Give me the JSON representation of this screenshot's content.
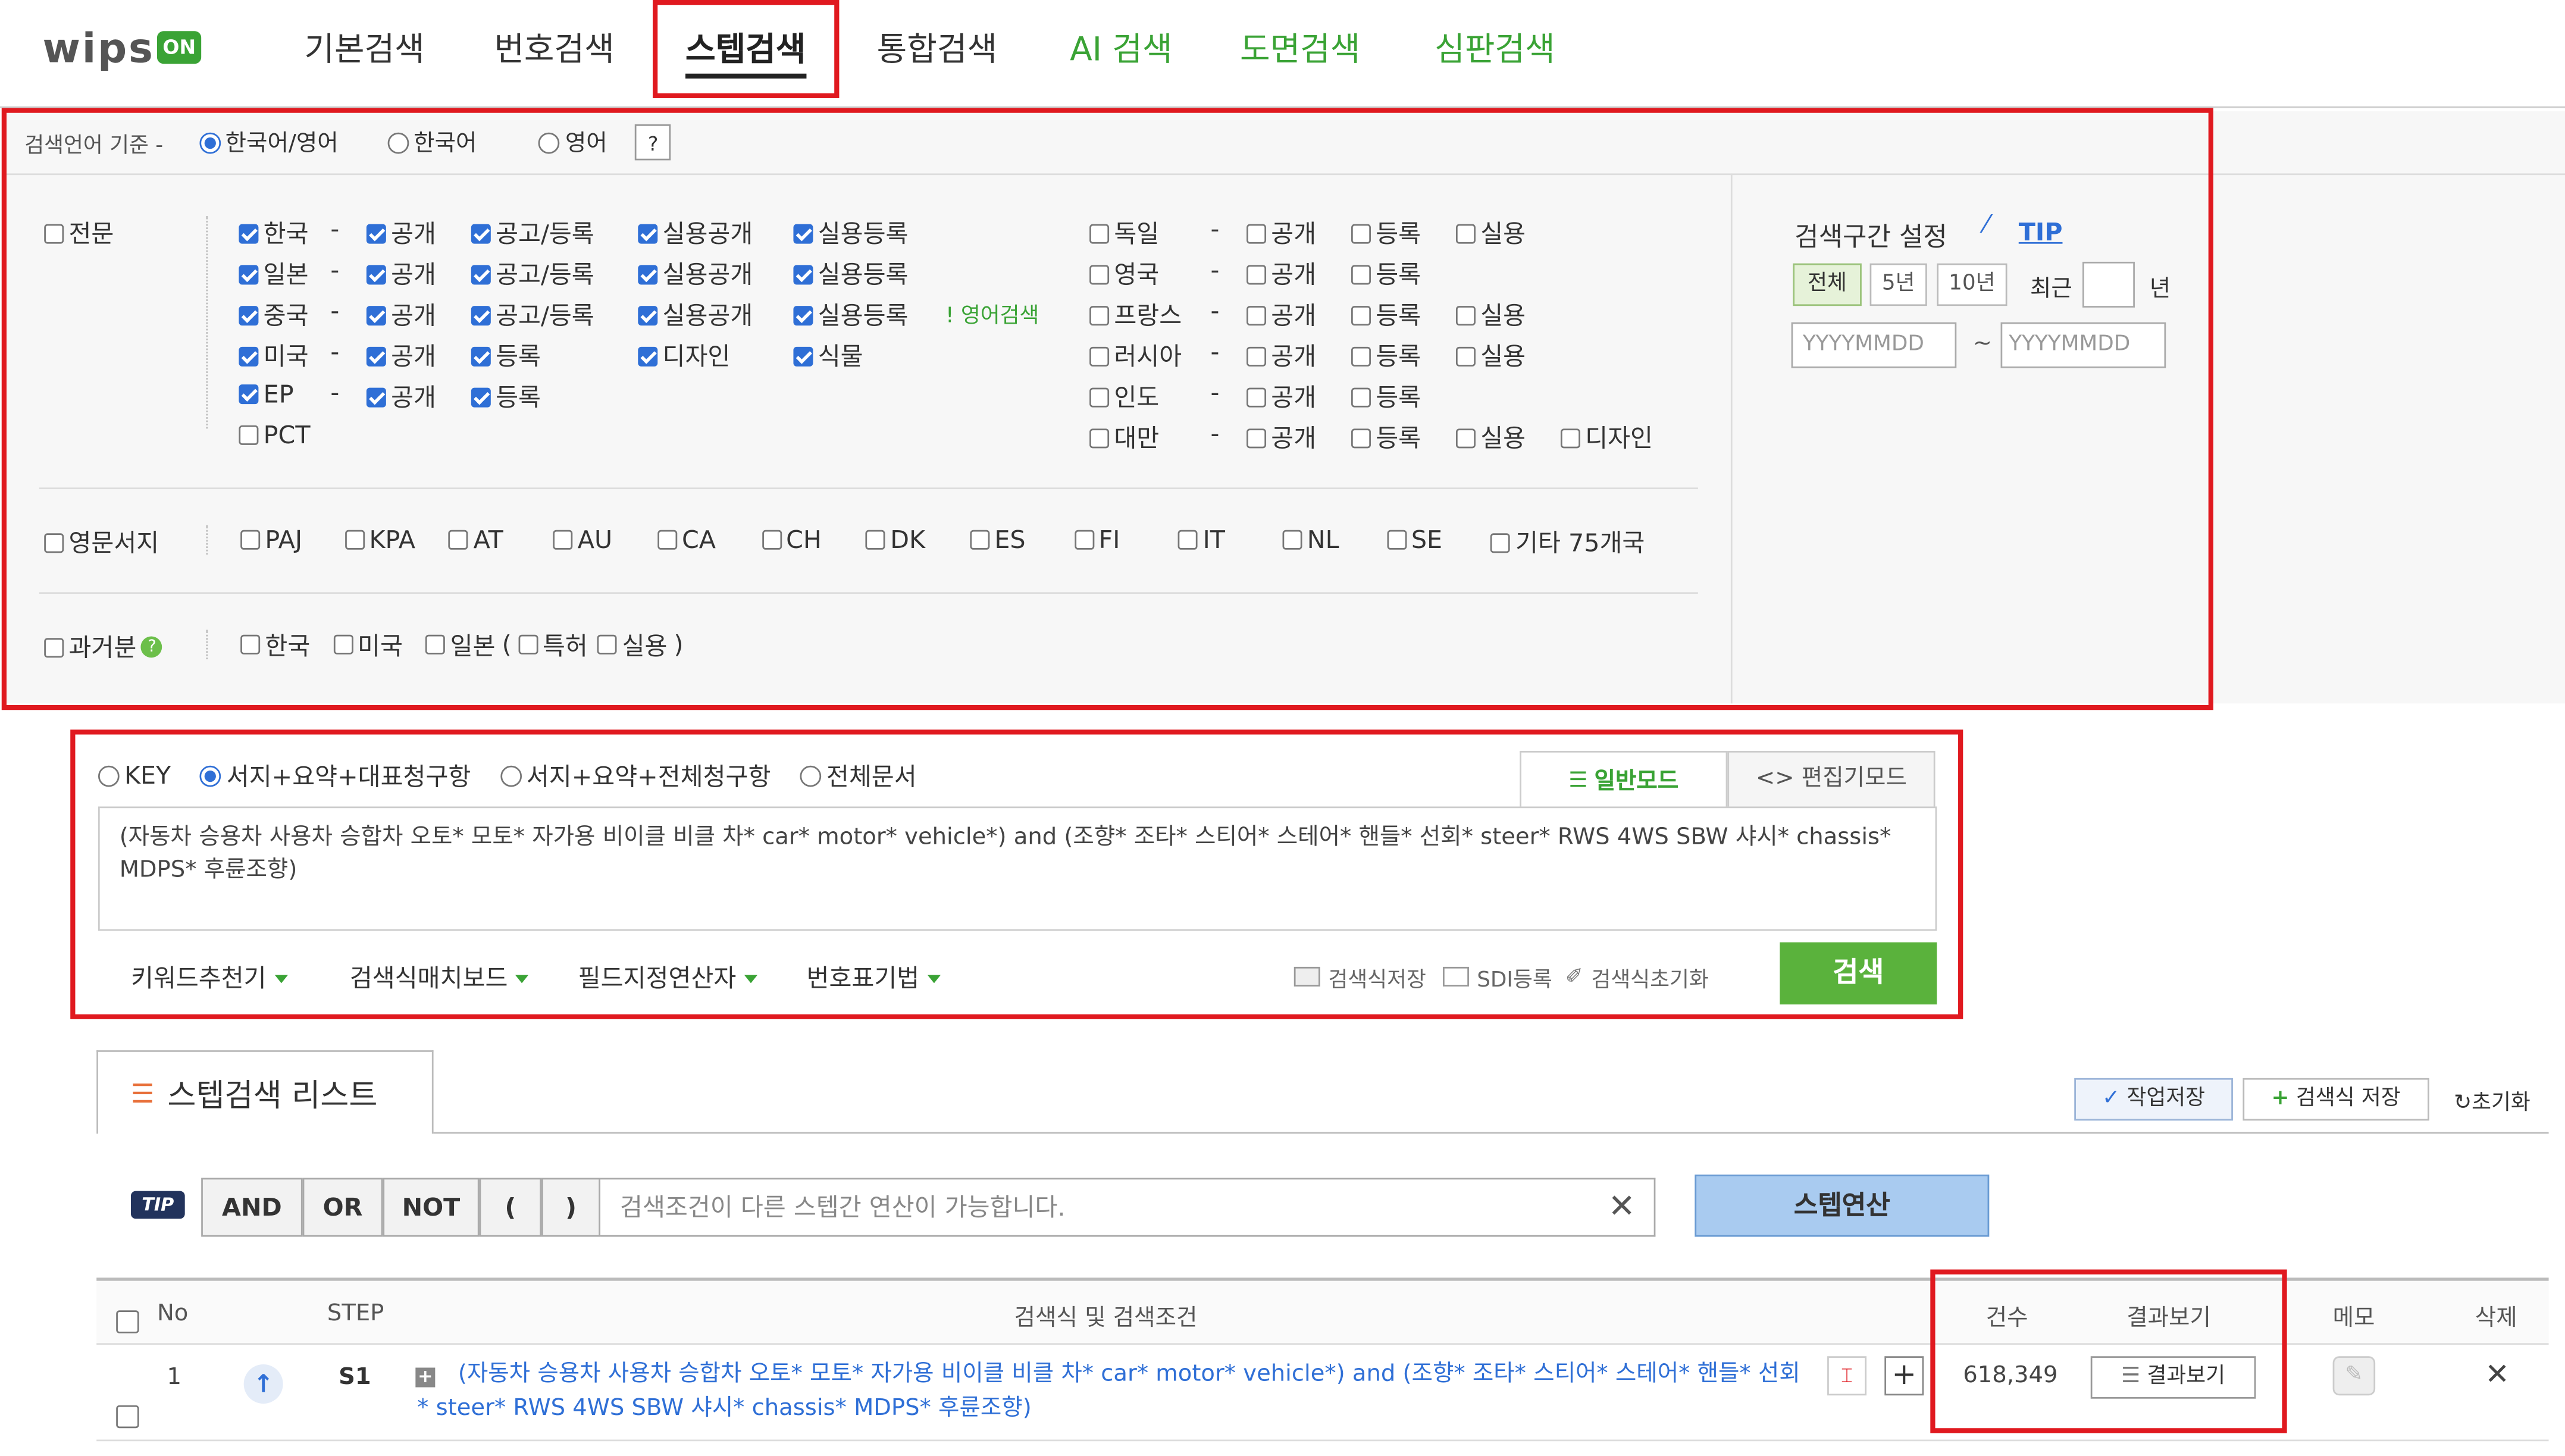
{
  "logo": {
    "text": "wips",
    "badge": "ON"
  },
  "nav": {
    "items": [
      {
        "label": "기본검색"
      },
      {
        "label": "번호검색"
      },
      {
        "label": "스텝검색"
      },
      {
        "label": "통합검색"
      },
      {
        "label": "AI 검색"
      },
      {
        "label": "도면검색"
      },
      {
        "label": "심판검색"
      }
    ]
  },
  "lang": {
    "prefix": "검색언어 기준 -",
    "options": [
      "한국어/영어",
      "한국어",
      "영어"
    ],
    "selected": "한국어/영어",
    "help": "?"
  },
  "countries": {
    "jeonmun": "전문",
    "left": [
      {
        "name": "한국",
        "dash": "-",
        "opts": [
          "공개",
          "공고/등록",
          "실용공개",
          "실용등록"
        ]
      },
      {
        "name": "일본",
        "dash": "-",
        "opts": [
          "공개",
          "공고/등록",
          "실용공개",
          "실용등록"
        ]
      },
      {
        "name": "중국",
        "dash": "-",
        "opts": [
          "공개",
          "공고/등록",
          "실용공개",
          "실용등록"
        ],
        "note": "! 영어검색"
      },
      {
        "name": "미국",
        "dash": "-",
        "opts": [
          "공개",
          "등록",
          "디자인",
          "식물"
        ]
      },
      {
        "name": "EP",
        "dash": "-",
        "opts": [
          "공개",
          "등록"
        ]
      },
      {
        "name": "PCT",
        "dash": "",
        "opts": []
      }
    ],
    "right": [
      {
        "name": "독일",
        "dash": "-",
        "opts": [
          "공개",
          "등록",
          "실용"
        ]
      },
      {
        "name": "영국",
        "dash": "-",
        "opts": [
          "공개",
          "등록"
        ]
      },
      {
        "name": "프랑스",
        "dash": "-",
        "opts": [
          "공개",
          "등록",
          "실용"
        ]
      },
      {
        "name": "러시아",
        "dash": "-",
        "opts": [
          "공개",
          "등록",
          "실용"
        ]
      },
      {
        "name": "인도",
        "dash": "-",
        "opts": [
          "공개",
          "등록"
        ]
      },
      {
        "name": "대만",
        "dash": "-",
        "opts": [
          "공개",
          "등록",
          "실용",
          "디자인"
        ]
      }
    ],
    "eng_label": "영문서지",
    "eng": [
      "PAJ",
      "KPA",
      "AT",
      "AU",
      "CA",
      "CH",
      "DK",
      "ES",
      "FI",
      "IT",
      "NL",
      "SE",
      "기타 75개국"
    ],
    "past_label": "과거분",
    "past": {
      "kr": "한국",
      "us": "미국",
      "jp": "일본",
      "paren_open": "(",
      "patent": "특허",
      "utility": "실용",
      "paren_close": ")"
    }
  },
  "period": {
    "title": "검색구간 설정",
    "tip": "TIP",
    "buttons": [
      "전체",
      "5년",
      "10년"
    ],
    "recent": "최근",
    "year": "년",
    "from_placeholder": "YYYYMMDD",
    "tilde": "~",
    "to_placeholder": "YYYYMMDD"
  },
  "scope": {
    "options": [
      "KEY",
      "서지+요약+대표청구항",
      "서지+요약+전체청구항",
      "전체문서"
    ],
    "selected": "서지+요약+대표청구항"
  },
  "modes": {
    "normal": "일반모드",
    "edit": "<> 편집기모드"
  },
  "query": "(자동차 승용차 사용차 승합차 오토* 모토* 자가용 비이클 비클 차* car* motor* vehicle*) and (조향* 조타* 스티어* 스테어* 핸들* 선회* steer* RWS 4WS SBW 샤시* chassis* MDPS* 후륜조향)",
  "tools": {
    "dropdowns": [
      "키워드추천기",
      "검색식매치보드",
      "필드지정연산자",
      "번호표기법"
    ],
    "save": "검색식저장",
    "sdi": "SDI등록",
    "reset": "검색식초기화",
    "search": "검색"
  },
  "steplist": {
    "title": "스텝검색 리스트",
    "save_work": "작업저장",
    "save_query": "검색식 저장",
    "reset": "초기화"
  },
  "ops": {
    "tip": "TIP",
    "buttons": [
      "AND",
      "OR",
      "NOT",
      "(",
      ")"
    ],
    "placeholder": "검색조건이 다른 스텝간 연산이 가능합니다.",
    "run": "스텝연산"
  },
  "table": {
    "headers": {
      "no": "No",
      "step": "STEP",
      "query": "검색식 및 검색조건",
      "count": "건수",
      "result": "결과보기",
      "memo": "메모",
      "delete": "삭제"
    },
    "rows": [
      {
        "no": "1",
        "step": "S1",
        "query": "(자동차 승용차 사용차 승합차 오토* 모토* 자가용 비이클 비클 차* car* motor* vehicle*) and (조향* 조타* 스티어* 스테어* 핸들* 선회* steer* RWS 4WS SBW 샤시* chassis* MDPS* 후륜조향)",
        "count": "618,349",
        "result_btn": "결과보기"
      }
    ]
  },
  "colors": {
    "highlight_box": "#e0191f",
    "green": "#3aa335",
    "blue": "#2f6fd6"
  }
}
